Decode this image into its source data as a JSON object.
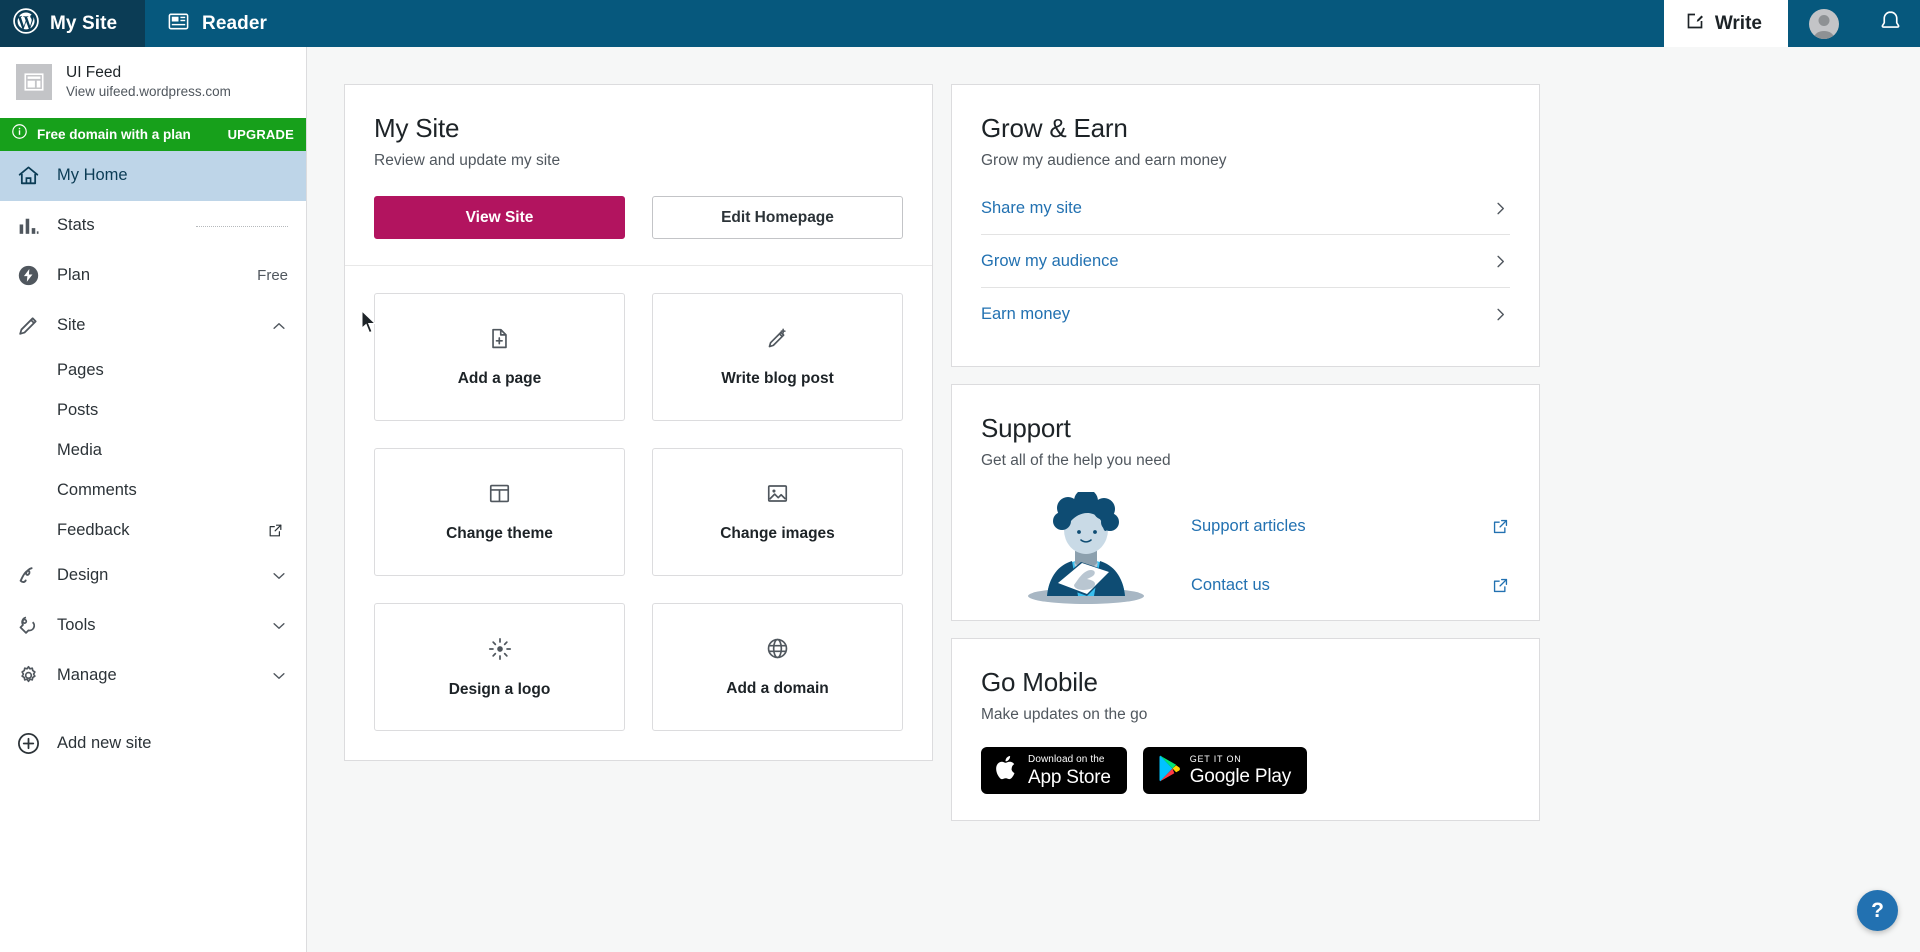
{
  "masthead": {
    "my_site_label": "My Site",
    "reader_label": "Reader",
    "write_label": "Write",
    "wordpress_icon": "wordpress-logo-icon",
    "reader_icon": "reader-icon",
    "write_icon": "write-plus-icon",
    "avatar_icon": "user-avatar",
    "bell_icon": "notifications-bell-icon",
    "bg_color": "#06587d",
    "my_site_bg_color": "#0b3c55"
  },
  "sidebar": {
    "site": {
      "name": "UI Feed",
      "url": "View uifeed.wordpress.com",
      "thumb_icon": "site-thumbnail-icon"
    },
    "upsell": {
      "text": "Free domain with a plan",
      "cta": "UPGRADE",
      "icon": "info-circle-icon",
      "bg_color": "#17a01b"
    },
    "items": [
      {
        "label": "My Home",
        "icon": "home-icon",
        "active": true,
        "meta": ""
      },
      {
        "label": "Stats",
        "icon": "stats-bars-icon",
        "active": false,
        "meta": "sparkline"
      },
      {
        "label": "Plan",
        "icon": "plan-bolt-icon",
        "active": false,
        "meta": "Free"
      },
      {
        "label": "Site",
        "icon": "pencil-icon",
        "active": false,
        "meta": "chevron-up"
      }
    ],
    "sub_items": [
      {
        "label": "Pages",
        "external": false
      },
      {
        "label": "Posts",
        "external": false
      },
      {
        "label": "Media",
        "external": false
      },
      {
        "label": "Comments",
        "external": false
      },
      {
        "label": "Feedback",
        "external": true
      }
    ],
    "items_bottom": [
      {
        "label": "Design",
        "icon": "design-squiggle-icon",
        "meta": "chevron-down"
      },
      {
        "label": "Tools",
        "icon": "wrench-icon",
        "meta": "chevron-down"
      },
      {
        "label": "Manage",
        "icon": "gear-icon",
        "meta": "chevron-down"
      }
    ],
    "add_site": {
      "label": "Add new site",
      "icon": "plus-circle-icon"
    }
  },
  "my_site_card": {
    "title": "My Site",
    "subtitle": "Review and update my site",
    "primary_button": "View Site",
    "secondary_button": "Edit Homepage",
    "primary_color": "#b2145f",
    "tiles": [
      {
        "label": "Add a page",
        "icon": "page-add-icon"
      },
      {
        "label": "Write blog post",
        "icon": "pencil-post-icon"
      },
      {
        "label": "Change theme",
        "icon": "layout-theme-icon"
      },
      {
        "label": "Change images",
        "icon": "image-icon"
      },
      {
        "label": "Design a logo",
        "icon": "sparkle-logo-icon"
      },
      {
        "label": "Add a domain",
        "icon": "globe-icon"
      }
    ]
  },
  "grow_earn_card": {
    "title": "Grow & Earn",
    "subtitle": "Grow my audience and earn money",
    "links": [
      {
        "label": "Share my site",
        "icon": "chevron-right-icon"
      },
      {
        "label": "Grow my audience",
        "icon": "chevron-right-icon"
      },
      {
        "label": "Earn money",
        "icon": "chevron-right-icon"
      }
    ],
    "link_color": "#2271b1"
  },
  "support_card": {
    "title": "Support",
    "subtitle": "Get all of the help you need",
    "illustration": "support-person-illustration",
    "links": [
      {
        "label": "Support articles",
        "icon": "external-link-icon"
      },
      {
        "label": "Contact us",
        "icon": "external-link-icon"
      }
    ]
  },
  "go_mobile_card": {
    "title": "Go Mobile",
    "subtitle": "Make updates on the go",
    "badges": [
      {
        "small": "Download on the",
        "big": "App Store",
        "icon": "apple-logo-icon"
      },
      {
        "small": "GET IT ON",
        "big": "Google Play",
        "icon": "google-play-icon"
      }
    ]
  },
  "help_fab": {
    "label": "?",
    "icon": "help-question-icon",
    "color": "#2271b1"
  }
}
